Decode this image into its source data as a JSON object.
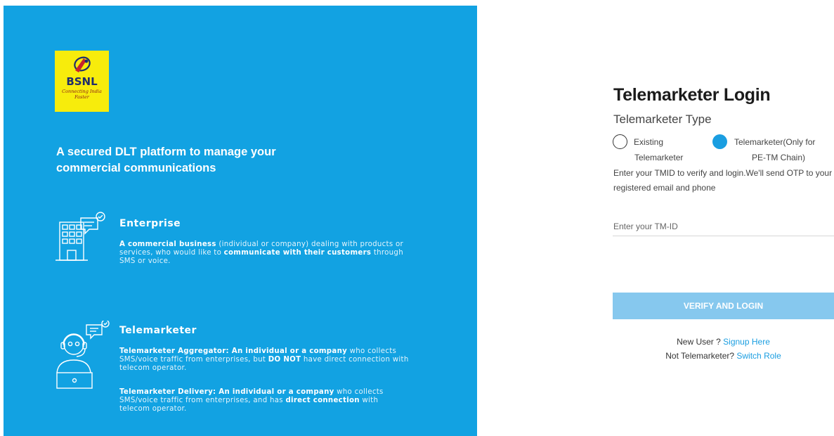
{
  "brand": {
    "logo_text": "BSNL",
    "logo_tagline": "Connecting India Faster"
  },
  "left": {
    "headline": "A secured DLT platform to manage your commercial communications",
    "enterprise": {
      "title": "Enterprise",
      "desc_bold1": "A commercial business",
      "desc_mid": " (individual or company) dealing with products or services, who would like to ",
      "desc_bold2": "communicate with their customers",
      "desc_end": " through SMS or voice."
    },
    "telemarketer": {
      "title": "Telemarketer",
      "agg_bold1": "Telemarketer Aggregator: An individual or a company",
      "agg_mid": " who collects SMS/voice traffic from enterprises, but ",
      "agg_bold2": "DO NOT",
      "agg_end": " have direct connection with telecom operator.",
      "del_bold1": "Telemarketer Delivery: An individual or a company",
      "del_mid": " who collects SMS/voice traffic from enterprises, and has ",
      "del_bold2": "direct connection",
      "del_end": " with telecom operator."
    }
  },
  "login": {
    "title": "Telemarketer Login",
    "type_label": "Telemarketer Type",
    "option_existing_line1": "Existing",
    "option_existing_line2": "Telemarketer",
    "option_petm_line1": "Telemarketer(Only for",
    "option_petm_line2": "PE-TM Chain)",
    "selected_option": "PE-TM Chain",
    "info": "Enter your TMID to verify and login.We'll send OTP to your registered email and phone",
    "tmid_value": "",
    "tmid_placeholder": "Enter your TM-ID",
    "verify_button": "VERIFY AND LOGIN",
    "new_user_text": "New User ? ",
    "signup_link": "Signup Here",
    "not_tm_text": "Not Telemarketer? ",
    "switch_role_link": "Switch Role"
  },
  "colors": {
    "panel_blue": "#12a2e2",
    "logo_yellow": "#f7ec0c",
    "accent_blue": "#1a9ee1",
    "button_blue": "#86c8ee"
  }
}
